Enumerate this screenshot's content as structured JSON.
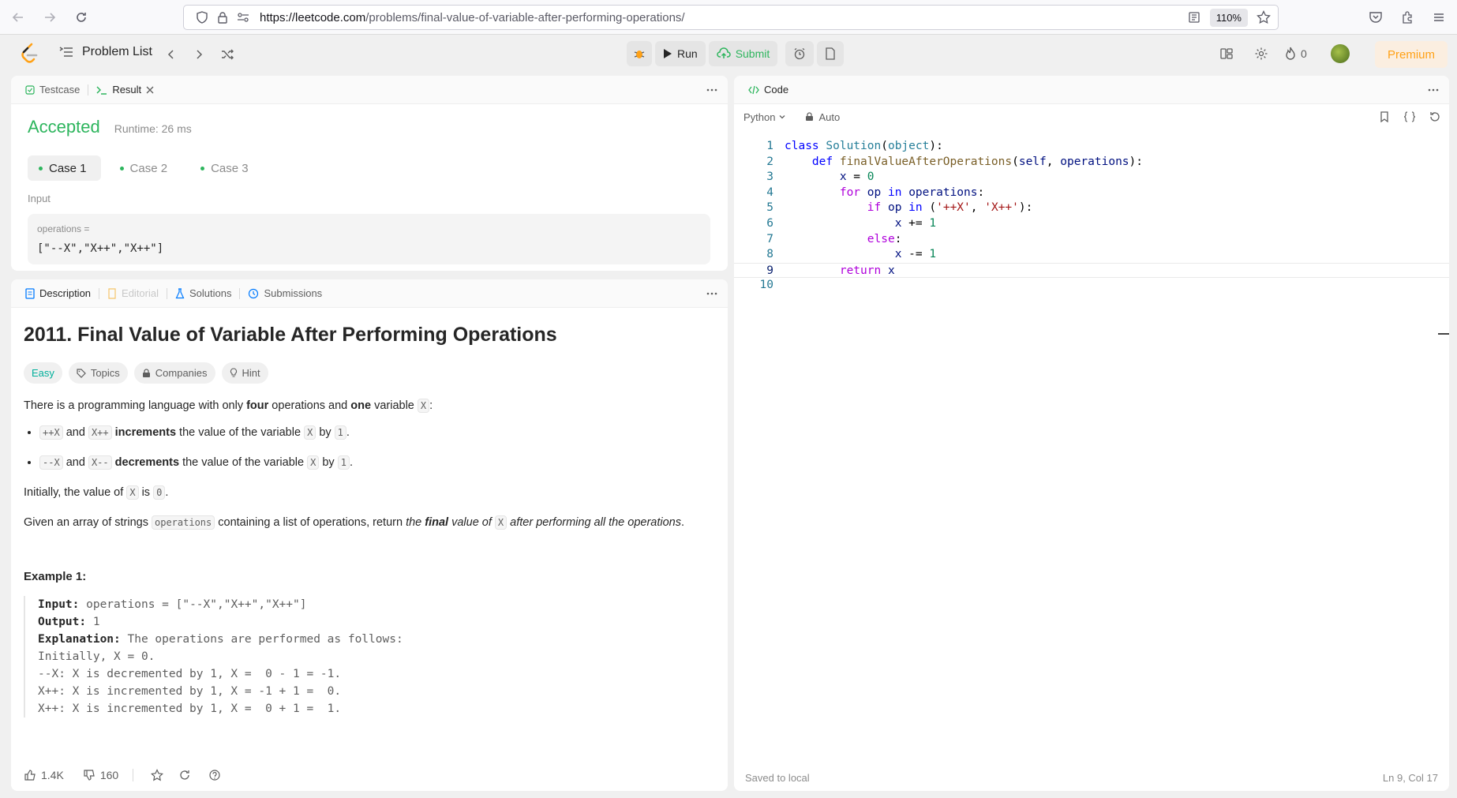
{
  "browser": {
    "url_host": "https://leetcode.com",
    "url_path": "/problems/final-value-of-variable-after-performing-operations/",
    "zoom": "110%"
  },
  "header": {
    "problem_list_label": "Problem List",
    "run_label": "Run",
    "submit_label": "Submit",
    "streak_count": "0",
    "premium_label": "Premium"
  },
  "result_panel": {
    "tabs": [
      "Testcase",
      "Result"
    ],
    "status": "Accepted",
    "runtime": "Runtime: 26 ms",
    "cases": [
      "Case 1",
      "Case 2",
      "Case 3"
    ],
    "input_label": "Input",
    "input_var": "operations =",
    "input_value": "[\"--X\",\"X++\",\"X++\"]"
  },
  "desc_panel": {
    "tabs": [
      "Description",
      "Editorial",
      "Solutions",
      "Submissions"
    ],
    "title": "2011. Final Value of Variable After Performing Operations",
    "chips": [
      "Easy",
      "Topics",
      "Companies",
      "Hint"
    ],
    "para1_a": "There is a programming language with only ",
    "para1_b": "four",
    "para1_c": " operations and ",
    "para1_d": "one",
    "para1_e": " variable ",
    "var_x": "X",
    "para1_f": ":",
    "bullet1": {
      "code1": "++X",
      "and": " and ",
      "code2": "X++",
      "bold": " increments",
      "rest": " the value of the variable ",
      "by": " by ",
      "one": "1",
      "end": "."
    },
    "bullet2": {
      "code1": "--X",
      "and": " and ",
      "code2": "X--",
      "bold": " decrements",
      "rest": " the value of the variable ",
      "by": " by ",
      "one": "1",
      "end": "."
    },
    "para2_a": "Initially, the value of ",
    "para2_b": " is ",
    "zero": "0",
    "para2_c": ".",
    "para3_a": "Given an array of strings ",
    "para3_code": "operations",
    "para3_b": " containing a list of operations, return ",
    "para3_c": "the ",
    "para3_d": "final",
    "para3_e": " value of ",
    "para3_f": " after performing all the operations",
    "para3_g": ".",
    "example_title": "Example 1:",
    "ex_input_label": "Input:",
    "ex_input": " operations = [\"--X\",\"X++\",\"X++\"]",
    "ex_output_label": "Output:",
    "ex_output": " 1",
    "ex_expl_label": "Explanation:",
    "ex_expl": " The operations are performed as follows:",
    "ex_line1": "Initially, X = 0.",
    "ex_line2": "--X: X is decremented by 1, X =  0 - 1 = -1.",
    "ex_line3": "X++: X is incremented by 1, X = -1 + 1 =  0.",
    "ex_line4": "X++: X is incremented by 1, X =  0 + 1 =  1.",
    "likes": "1.4K",
    "dislikes": "160"
  },
  "code_panel": {
    "tab": "Code",
    "language": "Python",
    "autosave": "Auto",
    "saved_text": "Saved to local",
    "cursor_pos": "Ln 9, Col 17",
    "line_numbers": [
      "1",
      "2",
      "3",
      "4",
      "5",
      "6",
      "7",
      "8",
      "9",
      "10"
    ]
  }
}
